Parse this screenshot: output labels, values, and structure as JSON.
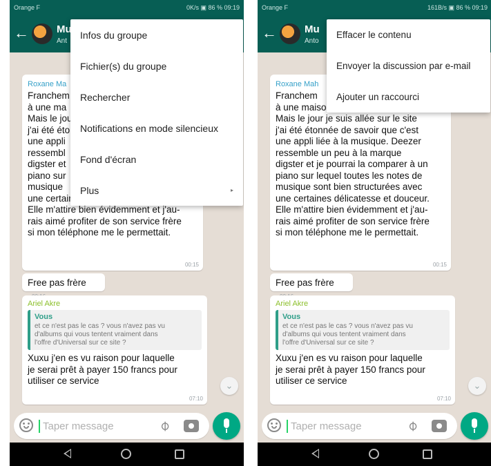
{
  "colors": {
    "header": "#075e54",
    "accent": "#00a884",
    "chat_bg": "#e5ddd5"
  },
  "left": {
    "status": {
      "carrier": "Orange F",
      "right": "0K/s ▣ 86 % 09:19"
    },
    "header": {
      "title": "Mu",
      "subtitle": "Ant"
    },
    "menu_items": [
      {
        "label": "Infos du groupe"
      },
      {
        "label": "Fichier(s) du groupe"
      },
      {
        "label": "Rechercher"
      },
      {
        "label": "Notifications en mode silencieux"
      },
      {
        "label": "Fond d'écran"
      },
      {
        "label": "Plus",
        "arrow": "▸"
      }
    ],
    "messages": {
      "m1_sender": "Roxane Ma",
      "m1_text": "Franchem\nà une ma\nMais le jou\nj'ai été éto\nune appli\nressembl\ndigster et\npiano sur\nmusique\nune certaines délicatesse et douceur.\nElle m'attire bien évidemment et j'au-\nrais aimé profiter de son service frère\nsi mon téléphone me le permettait.",
      "m1_time": "00:15",
      "m2_text": "Free pas frère",
      "m2_time": "00:16",
      "m3_sender": "Ariel Akre",
      "m3_quote_sender": "Vous",
      "m3_quote_text": "et ce n'est pas le cas ? vous n'avez pas vu\nd'albums qui vous tentent vraiment dans\nl'offre d'Universal sur ce site ?",
      "m3_text": "Xuxu j'en es vu raison pour laquelle\nje serai prêt à payer 150 francs pour\nutiliser ce service",
      "m3_time": "07:10"
    },
    "input": {
      "placeholder": "Taper message"
    },
    "scroll_icon": "⌄"
  },
  "right": {
    "status": {
      "carrier": "Orange F",
      "right": "161B/s ▣ 86 % 09:19"
    },
    "header": {
      "title": "Mu",
      "subtitle": "Anto"
    },
    "menu_items": [
      {
        "label": "Effacer le contenu"
      },
      {
        "label": "Envoyer la discussion par e-mail"
      },
      {
        "label": "Ajouter un raccourci"
      }
    ],
    "messages": {
      "m1_sender": "Roxane Mah",
      "m1_text": "Franchem\nà une maison de design immobilier.\nMais le jour je suis allée sur le site\nj'ai été étonnée de savoir que c'est\nune appli liée à la musique. Deezer\nressemble un peu à la marque\ndigster et je pourrai la comparer  à un\npiano sur lequel toutes les notes de\nmusique sont bien structurées avec\nune certaines délicatesse et douceur.\nElle m'attire bien évidemment et j'au-\nrais aimé profiter de son service frère\nsi mon téléphone me le permettait.",
      "m1_time": "00:15",
      "m2_text": "Free pas frère",
      "m2_time": "00:16",
      "m3_sender": "Ariel Akre",
      "m3_quote_sender": "Vous",
      "m3_quote_text": "et ce n'est pas le cas ? vous n'avez pas vu\nd'albums qui vous tentent vraiment dans\nl'offre d'Universal sur ce site ?",
      "m3_text": "Xuxu j'en es vu raison pour laquelle\nje serai prêt à payer 150 francs pour\nutiliser ce service",
      "m3_time": "07:10"
    },
    "input": {
      "placeholder": "Taper message"
    },
    "scroll_icon": "⌄"
  }
}
